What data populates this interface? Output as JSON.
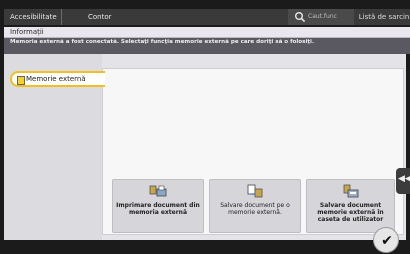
{
  "topbar": {
    "accessibility_label": "Accesibilitate",
    "counter_label": "Contor",
    "search_placeholder": "Caut.func",
    "job_list_label": "Listă de sarcini"
  },
  "info": {
    "title": "Informații",
    "message": "Memoria externă a fost conectată. Selectaţi funcţia memorie externă pe care doriţi să o folosiţi."
  },
  "sidebar": {
    "tab_label": "Memorie externă"
  },
  "actions": [
    {
      "label": "Imprimare document din memoria externă",
      "bold": true,
      "icon": "print-from-memory-icon"
    },
    {
      "label": "Salvare document pe o memorie externă.",
      "bold": false,
      "icon": "save-to-memory-icon"
    },
    {
      "label": "Salvare document memorie externă în caseta de utilizator",
      "bold": true,
      "icon": "save-to-user-box-icon"
    }
  ],
  "side_arrow": "◀◀",
  "ok_symbol": "✔"
}
